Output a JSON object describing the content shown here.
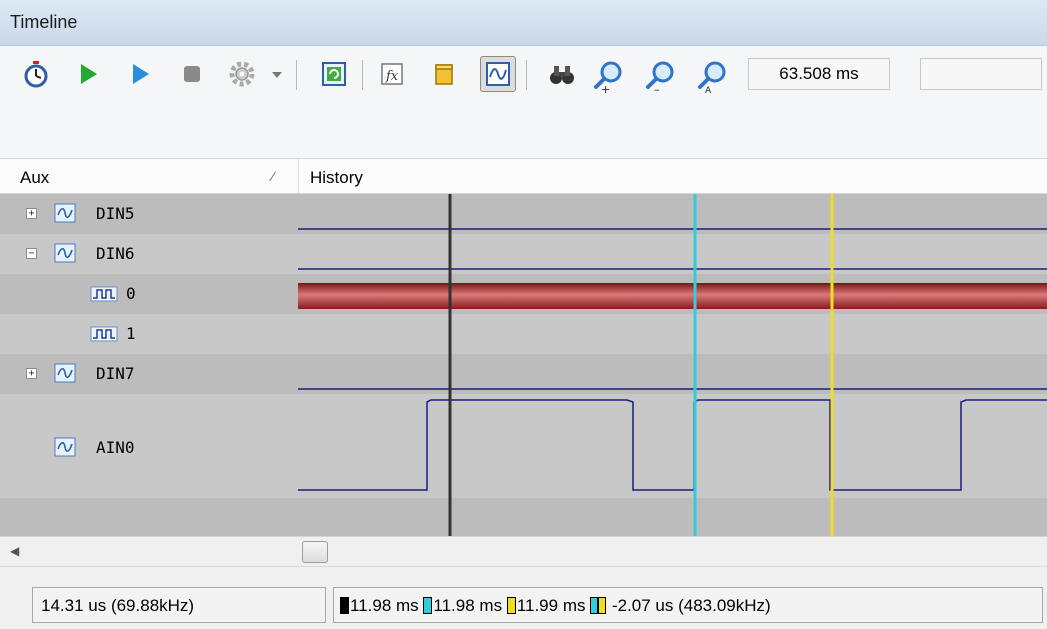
{
  "window": {
    "title": "Timeline"
  },
  "toolbar": {
    "buttons": [
      {
        "icon": "stopwatch-icon"
      },
      {
        "icon": "play-green-icon"
      },
      {
        "icon": "play-blue-icon"
      },
      {
        "icon": "stop-icon"
      },
      {
        "icon": "gear-icon"
      },
      {
        "icon": "dropdown-arrow-icon"
      },
      {
        "icon": "refresh-view-icon"
      },
      {
        "icon": "function-icon"
      },
      {
        "icon": "cylinder-icon"
      },
      {
        "icon": "waveform-toggle-icon",
        "pressed": true
      },
      {
        "icon": "binoculars-icon"
      },
      {
        "icon": "zoom-in-icon"
      },
      {
        "icon": "zoom-out-icon"
      },
      {
        "icon": "zoom-auto-icon"
      }
    ],
    "time_value": "63.508 ms",
    "secondary_value": ""
  },
  "columns": {
    "aux": "Aux",
    "history": "History"
  },
  "signals": [
    {
      "name": "DIN5",
      "expander": "+"
    },
    {
      "name": "DIN6",
      "expander": "−"
    },
    {
      "name": "0",
      "bit": true
    },
    {
      "name": "1",
      "bit": true
    },
    {
      "name": "DIN7",
      "expander": "+"
    },
    {
      "name": "AIN0"
    }
  ],
  "cursors": {
    "colors": {
      "black": "#333333",
      "cyan": "#33ccdd",
      "yellow": "#eedd22"
    }
  },
  "colors": {
    "trace": "#1a1a80",
    "bit0_fill": "#b23333"
  },
  "status": {
    "left": "14.31 us (69.88kHz)",
    "black_value": "11.98 ms",
    "cyan_value": "11.98 ms",
    "yellow_value": "11.99 ms",
    "delta_value": "-2.07 us (483.09kHz)"
  }
}
